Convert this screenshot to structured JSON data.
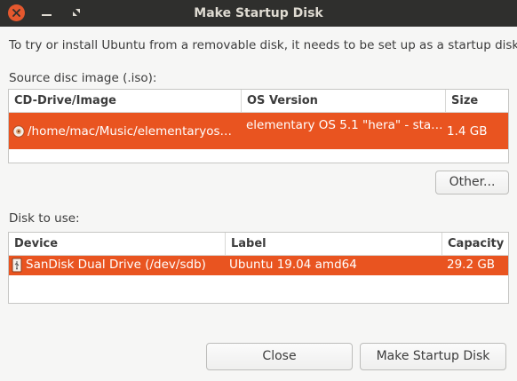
{
  "window": {
    "title": "Make Startup Disk"
  },
  "intro_text": "To try or install Ubuntu from a removable disk, it needs to be set up as a startup disk.",
  "source": {
    "label": "Source disc image (.iso):",
    "columns": [
      "CD-Drive/Image",
      "OS Version",
      "Size"
    ],
    "rows": [
      {
        "image": "/home/mac/Music/elementaryos…",
        "os_version": "elementary OS 5.1 \"hera\" - sta…",
        "size": "1.4 GB"
      }
    ],
    "other_button": "Other..."
  },
  "disk": {
    "label": "Disk to use:",
    "columns": [
      "Device",
      "Label",
      "Capacity"
    ],
    "rows": [
      {
        "device": "SanDisk Dual Drive (/dev/sdb)",
        "label": "Ubuntu 19.04 amd64",
        "capacity": "29.2 GB"
      }
    ]
  },
  "buttons": {
    "close": "Close",
    "make": "Make Startup Disk"
  },
  "colors": {
    "accent": "#e95420",
    "titlebar": "#2f2f2d",
    "close_button": "#e5582e",
    "background": "#f6f6f5"
  },
  "icons": {
    "image_row": "disc-icon",
    "device_row": "usb-drive-icon"
  }
}
